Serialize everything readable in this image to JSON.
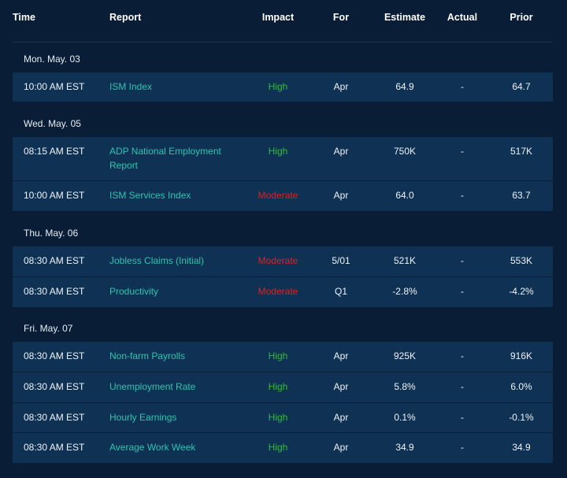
{
  "columns": {
    "time": "Time",
    "report": "Report",
    "impact": "Impact",
    "for": "For",
    "estimate": "Estimate",
    "actual": "Actual",
    "prior": "Prior"
  },
  "groups": [
    {
      "date": "Mon. May. 03",
      "rows": [
        {
          "time": "10:00 AM EST",
          "report": "ISM Index",
          "impact": "High",
          "for": "Apr",
          "estimate": "64.9",
          "actual": "-",
          "prior": "64.7"
        }
      ]
    },
    {
      "date": "Wed. May. 05",
      "rows": [
        {
          "time": "08:15 AM EST",
          "report_line1": "ADP National Employment",
          "report_line2": "Report",
          "impact": "High",
          "for": "Apr",
          "estimate": "750K",
          "actual": "-",
          "prior": "517K"
        },
        {
          "time": "10:00 AM EST",
          "report": "ISM Services Index",
          "impact": "Moderate",
          "for": "Apr",
          "estimate": "64.0",
          "actual": "-",
          "prior": "63.7"
        }
      ]
    },
    {
      "date": "Thu. May. 06",
      "rows": [
        {
          "time": "08:30 AM EST",
          "report": "Jobless Claims (Initial)",
          "impact": "Moderate",
          "for": "5/01",
          "estimate": "521K",
          "actual": "-",
          "prior": "553K"
        },
        {
          "time": "08:30 AM EST",
          "report": "Productivity",
          "impact": "Moderate",
          "for": "Q1",
          "estimate": "-2.8%",
          "actual": "-",
          "prior": "-4.2%"
        }
      ]
    },
    {
      "date": "Fri. May. 07",
      "rows": [
        {
          "time": "08:30 AM EST",
          "report": "Non-farm Payrolls",
          "impact": "High",
          "for": "Apr",
          "estimate": "925K",
          "actual": "-",
          "prior": "916K"
        },
        {
          "time": "08:30 AM EST",
          "report": "Unemployment Rate",
          "impact": "High",
          "for": "Apr",
          "estimate": "5.8%",
          "actual": "-",
          "prior": "6.0%"
        },
        {
          "time": "08:30 AM EST",
          "report": "Hourly Earnings",
          "impact": "High",
          "for": "Apr",
          "estimate": "0.1%",
          "actual": "-",
          "prior": "-0.1%"
        },
        {
          "time": "08:30 AM EST",
          "report": "Average Work Week",
          "impact": "High",
          "for": "Apr",
          "estimate": "34.9",
          "actual": "-",
          "prior": "34.9"
        }
      ]
    }
  ],
  "colors": {
    "background": "#0a1d36",
    "row": "#0f3154",
    "report": "#2ec4b0",
    "high": "#2fbf2f",
    "moderate": "#e02020"
  }
}
